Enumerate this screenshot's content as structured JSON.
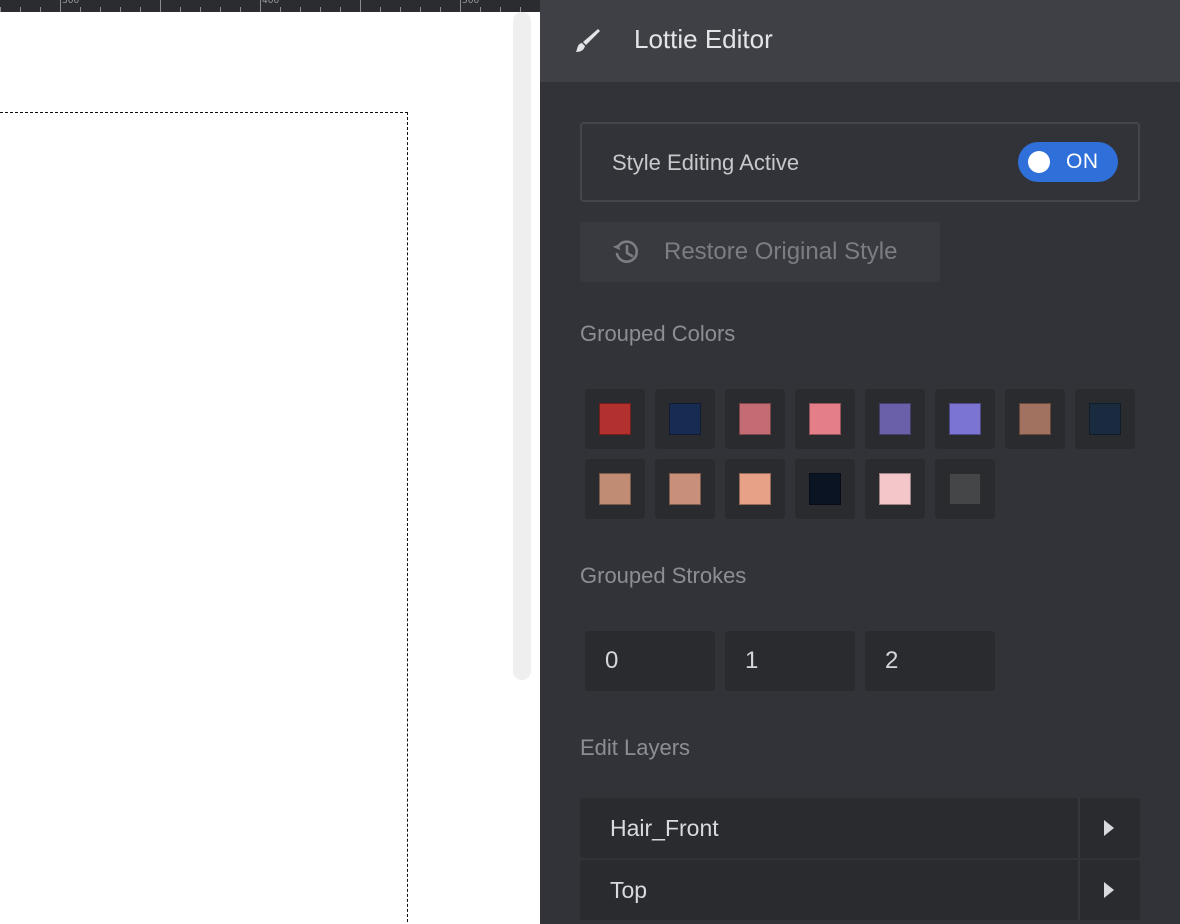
{
  "canvas": {
    "ruler_labels": [
      "300",
      "400",
      "500"
    ]
  },
  "panel": {
    "header": {
      "title": "Lottie Editor",
      "icon": "brush-icon"
    },
    "style_editing": {
      "label": "Style Editing Active",
      "toggle_text": "ON",
      "enabled": true
    },
    "restore_button": {
      "label": "Restore Original Style",
      "icon": "history-icon"
    },
    "grouped_colors": {
      "title": "Grouped Colors",
      "colors": [
        "#b2312f",
        "#182b50",
        "#c56b73",
        "#e47e88",
        "#6a60a9",
        "#7c74d2",
        "#a0725f",
        "#1b2b3f",
        "#c18c74",
        "#c8907a",
        "#e6a186",
        "#0a1422",
        "#f3c7ca",
        "#454648"
      ]
    },
    "grouped_strokes": {
      "title": "Grouped Strokes",
      "values": [
        "0",
        "1",
        "2"
      ]
    },
    "edit_layers": {
      "title": "Edit Layers",
      "layers": [
        "Hair_Front",
        "Top"
      ]
    }
  }
}
